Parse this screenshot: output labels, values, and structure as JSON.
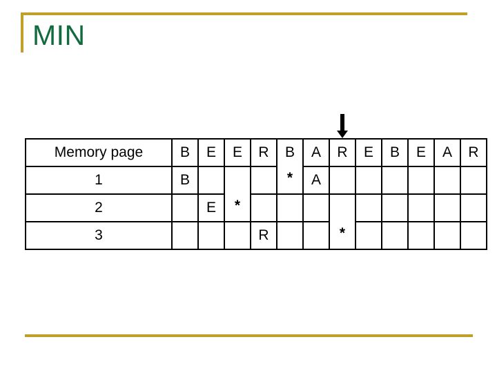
{
  "slide": {
    "title": "MIN",
    "colors": {
      "title_green": "#126b3f",
      "rule_gold": "#c0a028",
      "page_letter_purple": "#b57edc",
      "fault_red": "#c00000",
      "table_border": "#000000"
    }
  },
  "marker": {
    "icon": "arrow-down-icon",
    "points_at_column_index": 6,
    "points_at_value": "R"
  },
  "table": {
    "label_header": "Memory page",
    "reference_string": [
      "B",
      "E",
      "E",
      "R",
      "B",
      "A",
      "R",
      "E",
      "B",
      "E",
      "A",
      "R"
    ],
    "rows": [
      {
        "label": "1",
        "cells": [
          "B",
          "",
          "",
          "",
          "*",
          "A",
          "",
          "",
          "",
          "",
          "",
          ""
        ]
      },
      {
        "label": "2",
        "cells": [
          "",
          "E",
          "*",
          "",
          "",
          "",
          "",
          "",
          "",
          "",
          "",
          ""
        ]
      },
      {
        "label": "3",
        "cells": [
          "",
          "",
          "",
          "R",
          "",
          "",
          "*",
          "",
          "",
          "",
          "",
          ""
        ]
      }
    ]
  }
}
